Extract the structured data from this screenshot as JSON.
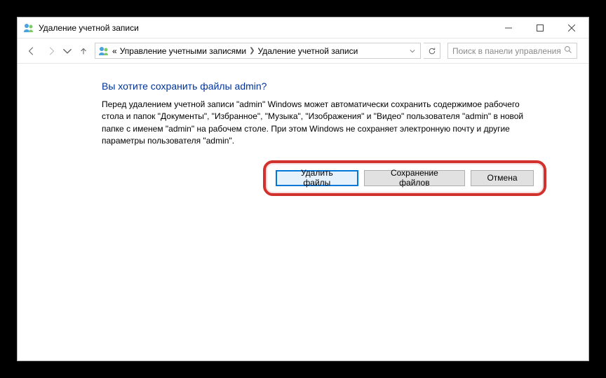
{
  "window": {
    "title": "Удаление учетной записи"
  },
  "nav": {
    "back_enabled": true,
    "forward_enabled": false,
    "breadcrumb_prefix": "«",
    "crumb1": "Управление учетными записями",
    "crumb2": "Удаление учетной записи"
  },
  "search": {
    "placeholder": "Поиск в панели управления"
  },
  "page": {
    "heading": "Вы хотите сохранить файлы admin?",
    "body": "Перед удалением учетной записи \"admin\" Windows может автоматически сохранить содержимое рабочего стола и папок \"Документы\", \"Избранное\", \"Музыка\", \"Изображения\" и \"Видео\" пользователя \"admin\" в новой папке с именем \"admin\" на рабочем столе. При этом Windows не сохраняет электронную почту и другие параметры пользователя \"admin\"."
  },
  "buttons": {
    "delete_files": "Удалить файлы",
    "save_files": "Сохранение файлов",
    "cancel": "Отмена"
  }
}
